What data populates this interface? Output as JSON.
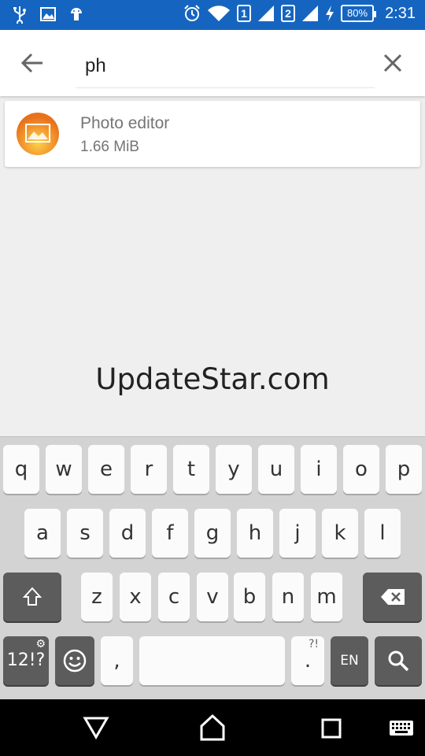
{
  "status_bar": {
    "sim1": "1",
    "sim2": "2",
    "battery": "80%",
    "time": "2:31"
  },
  "search": {
    "query": "ph"
  },
  "results": [
    {
      "name": "Photo editor",
      "size": "1.66 MiB",
      "icon": "photo-editor-icon"
    }
  ],
  "watermark": "UpdateStar.com",
  "keyboard": {
    "row1": [
      "q",
      "w",
      "e",
      "r",
      "t",
      "y",
      "u",
      "i",
      "o",
      "p"
    ],
    "row2": [
      "a",
      "s",
      "d",
      "f",
      "g",
      "h",
      "j",
      "k",
      "l"
    ],
    "row3": [
      "z",
      "x",
      "c",
      "v",
      "b",
      "n",
      "m"
    ],
    "symbols_key": "12!?",
    "comma_key": ",",
    "period_key": ".",
    "period_hint": "?!",
    "language_key": "EN"
  },
  "colors": {
    "status_bar": "#1565c0",
    "background": "#efefef",
    "key_dark": "#5c5c5c",
    "icon_orange": "#f0901e"
  }
}
